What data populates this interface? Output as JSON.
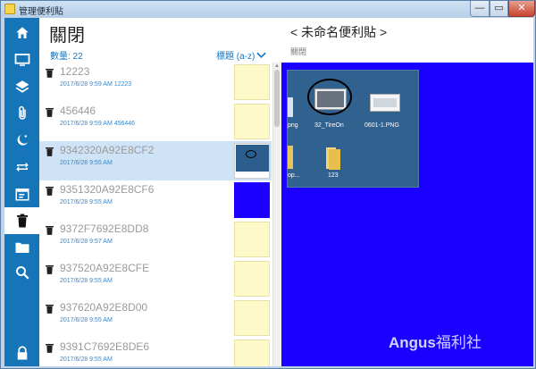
{
  "window": {
    "title": "管理便利貼",
    "close_glyph": "✕",
    "min_glyph": "—",
    "max_glyph": "▭"
  },
  "sidebar": {
    "items": [
      {
        "icon": "home-icon"
      },
      {
        "icon": "monitor-icon"
      },
      {
        "icon": "layers-icon"
      },
      {
        "icon": "paperclip-icon"
      },
      {
        "icon": "moon-star-icon"
      },
      {
        "icon": "repeat-icon"
      },
      {
        "icon": "calendar-icon"
      },
      {
        "icon": "trash-icon",
        "active": true
      },
      {
        "icon": "folder-icon"
      },
      {
        "icon": "search-icon"
      },
      {
        "icon": "lock-icon"
      }
    ],
    "accent": "#1674b8"
  },
  "list": {
    "title": "關閉",
    "count_label": "數量: 22",
    "sort_label": "標題 (a-z)",
    "items": [
      {
        "name": "12223",
        "date": "2017/6/28 9:59 AM 12223",
        "thumb": "yellow"
      },
      {
        "name": "456446",
        "date": "2017/6/28 9:59 AM 456446",
        "thumb": "yellow"
      },
      {
        "name": "9342320A92E8CF2",
        "date": "2017/6/28 9:55 AM",
        "thumb": "screenshot",
        "selected": true
      },
      {
        "name": "9351320A92E8CF6",
        "date": "2017/6/28 9:55 AM",
        "thumb": "blue"
      },
      {
        "name": "9372F7692E8DD8",
        "date": "2017/6/28 9:57 AM",
        "thumb": "yellow"
      },
      {
        "name": "937520A92E8CFE",
        "date": "2017/6/28 9:55 AM",
        "thumb": "yellow"
      },
      {
        "name": "937620A92E8D00",
        "date": "2017/6/28 9:55 AM",
        "thumb": "yellow"
      },
      {
        "name": "9391C7692E8DE6",
        "date": "2017/6/28 9:55 AM",
        "thumb": "yellow"
      }
    ]
  },
  "detail": {
    "title": "< 未命名便利貼 >",
    "status": "關閉",
    "canvas_color": "#1b00ff",
    "desktop": {
      "label_1": "png",
      "label_2": "32_TireOn",
      "label_3": "0601-1.PNG",
      "label_4": "op...",
      "label_5": "123"
    }
  },
  "watermark": {
    "latin": "Angus",
    "cn": "福利社"
  }
}
